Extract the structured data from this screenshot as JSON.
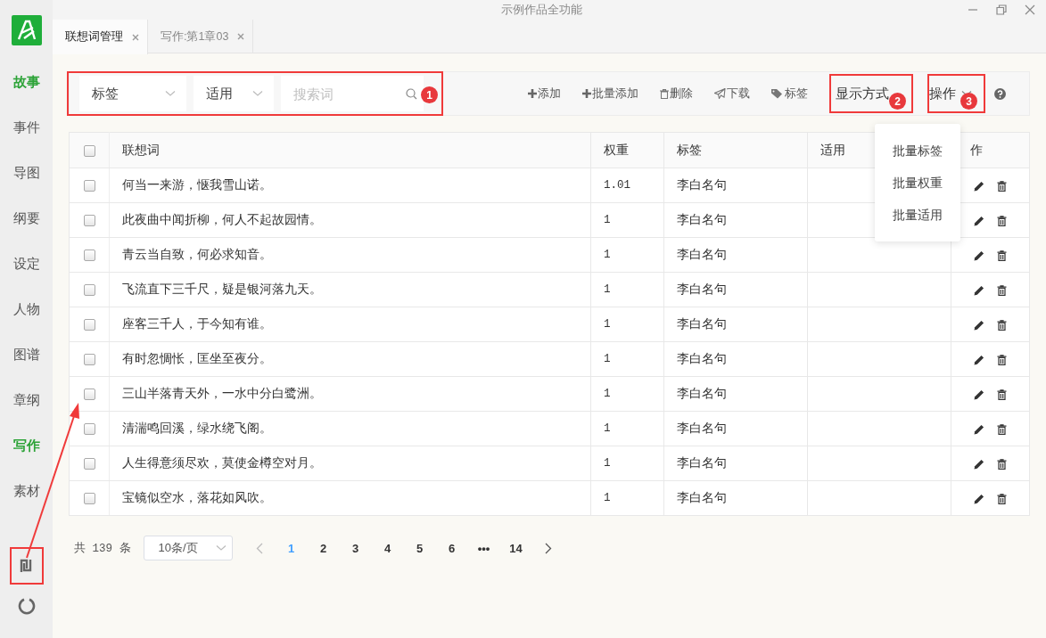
{
  "window": {
    "title": "示例作品全功能"
  },
  "sidebar": {
    "items": [
      {
        "label": "故事",
        "selected": true
      },
      {
        "label": "事件",
        "selected": false
      },
      {
        "label": "导图",
        "selected": false
      },
      {
        "label": "纲要",
        "selected": false
      },
      {
        "label": "设定",
        "selected": false
      },
      {
        "label": "人物",
        "selected": false
      },
      {
        "label": "图谱",
        "selected": false
      },
      {
        "label": "章纲",
        "selected": false
      },
      {
        "label": "写作",
        "selected": true
      },
      {
        "label": "素材",
        "selected": false
      }
    ]
  },
  "tabs": [
    {
      "label": "联想词管理",
      "selected": true
    },
    {
      "label": "写作:第1章03",
      "selected": false
    }
  ],
  "filters": {
    "tag_select": "标签",
    "scope_select": "适用",
    "search": {
      "placeholder": "搜索词"
    }
  },
  "toolbar": {
    "actions": [
      {
        "label": "添加",
        "kind": "plus"
      },
      {
        "label": "批量添加",
        "kind": "plus"
      },
      {
        "label": "删除",
        "kind": "trash"
      },
      {
        "label": "下载",
        "kind": "send"
      },
      {
        "label": "标签",
        "kind": "tag"
      }
    ],
    "display_menu": "显示方式",
    "operate_menu": "操作"
  },
  "operate_menu_items": [
    "批量标签",
    "批量权重",
    "批量适用"
  ],
  "table": {
    "header_checked": false,
    "columns": [
      "联想词",
      "权重",
      "标签",
      "适用",
      "作"
    ],
    "rows": [
      {
        "checked": false,
        "word": "何当一来游，惬我雪山诺。",
        "weight": "1.01",
        "tag": "李白名句"
      },
      {
        "checked": false,
        "word": "此夜曲中闻折柳，何人不起故园情。",
        "weight": "1",
        "tag": "李白名句"
      },
      {
        "checked": false,
        "word": "青云当自致，何必求知音。",
        "weight": "1",
        "tag": "李白名句"
      },
      {
        "checked": false,
        "word": "飞流直下三千尺，疑是银河落九天。",
        "weight": "1",
        "tag": "李白名句"
      },
      {
        "checked": false,
        "word": "座客三千人，于今知有谁。",
        "weight": "1",
        "tag": "李白名句"
      },
      {
        "checked": false,
        "word": "有时忽惆怅，匡坐至夜分。",
        "weight": "1",
        "tag": "李白名句"
      },
      {
        "checked": false,
        "word": "三山半落青天外，一水中分白鹭洲。",
        "weight": "1",
        "tag": "李白名句"
      },
      {
        "checked": false,
        "word": "清湍鸣回溪，绿水绕飞阁。",
        "weight": "1",
        "tag": "李白名句"
      },
      {
        "checked": false,
        "word": "人生得意须尽欢，莫使金樽空对月。",
        "weight": "1",
        "tag": "李白名句"
      },
      {
        "checked": false,
        "word": "宝镜似空水，落花如风吹。",
        "weight": "1",
        "tag": "李白名句"
      }
    ]
  },
  "pagination": {
    "total": "共 139 条",
    "page_size": "10条/页",
    "pages": [
      {
        "label": "1",
        "selected": true
      },
      {
        "label": "2",
        "selected": false
      },
      {
        "label": "3",
        "selected": false
      },
      {
        "label": "4",
        "selected": false
      },
      {
        "label": "5",
        "selected": false
      },
      {
        "label": "6",
        "selected": false
      },
      {
        "label": "•••",
        "selected": false
      },
      {
        "label": "14",
        "selected": false
      }
    ]
  },
  "annotations": {
    "markers": [
      "1",
      "2",
      "3"
    ]
  }
}
